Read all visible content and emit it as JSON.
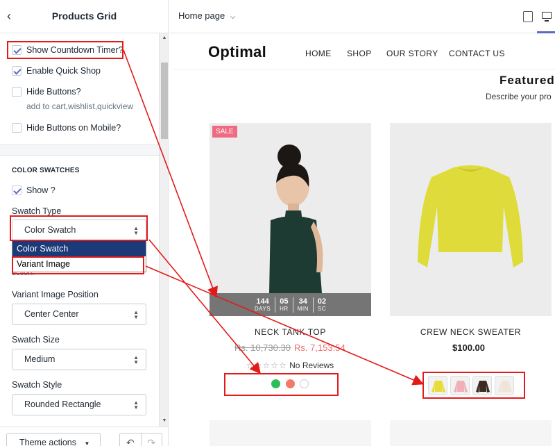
{
  "panel": {
    "back_icon": "chevron-left-icon",
    "title": "Products Grid",
    "options": [
      {
        "label": "Show Countdown Timer?",
        "checked": true
      },
      {
        "label": "Enable Quick Shop",
        "checked": true
      },
      {
        "label": "Hide Buttons?",
        "checked": false,
        "help": "add to cart,wishlist,quickview"
      },
      {
        "label": "Hide Buttons on Mobile?",
        "checked": false
      }
    ],
    "color_swatches": {
      "title": "COLOR SWATCHES",
      "show_label": "Show ?",
      "show_checked": true,
      "swatch_type_label": "Swatch Type",
      "swatch_type_value": "Color Swatch",
      "swatch_type_options": [
        "Color Swatch",
        "Variant Image"
      ],
      "obscured_help": "ection.",
      "image_position_label": "Variant Image Position",
      "image_position_value": "Center Center",
      "size_label": "Swatch Size",
      "size_value": "Medium",
      "style_label": "Swatch Style",
      "style_value": "Rounded Rectangle"
    },
    "footer": {
      "theme_actions": "Theme actions",
      "undo_icon": "undo-icon",
      "redo_icon": "redo-icon"
    }
  },
  "topbar": {
    "page_selector": "Home page",
    "devices": [
      "mobile-icon",
      "desktop-icon"
    ],
    "active_device": "desktop"
  },
  "store": {
    "logo": "Optimal",
    "nav": [
      "HOME",
      "SHOP",
      "OUR STORY",
      "CONTACT US"
    ],
    "featured_title": "Featured",
    "featured_sub": "Describe your pro",
    "products": [
      {
        "badge": "SALE",
        "name": "NECK TANK TOP",
        "price_old": "Rs. 10,730.30",
        "price_new": "Rs. 7,153.54",
        "reviews": "No Reviews",
        "timer": [
          {
            "value": "144",
            "unit": "DAYS"
          },
          {
            "value": "05",
            "unit": "HR"
          },
          {
            "value": "34",
            "unit": "MIN"
          },
          {
            "value": "02",
            "unit": "SC"
          }
        ],
        "swatch_colors": [
          "#2ebd5c",
          "#f27a66",
          "#ffffff"
        ]
      },
      {
        "name": "CREW NECK SWEATER",
        "price": "$100.00",
        "variant_colors": [
          "#e6dd3b",
          "#f1b0b8",
          "#3a2a22",
          "#f2e8dc"
        ]
      }
    ]
  },
  "colors": {
    "annotation_red": "#e31a1a",
    "accent": "#5c6ac4",
    "sale_badge": "#ef6b83",
    "dropdown_selected": "#1c3a78"
  }
}
